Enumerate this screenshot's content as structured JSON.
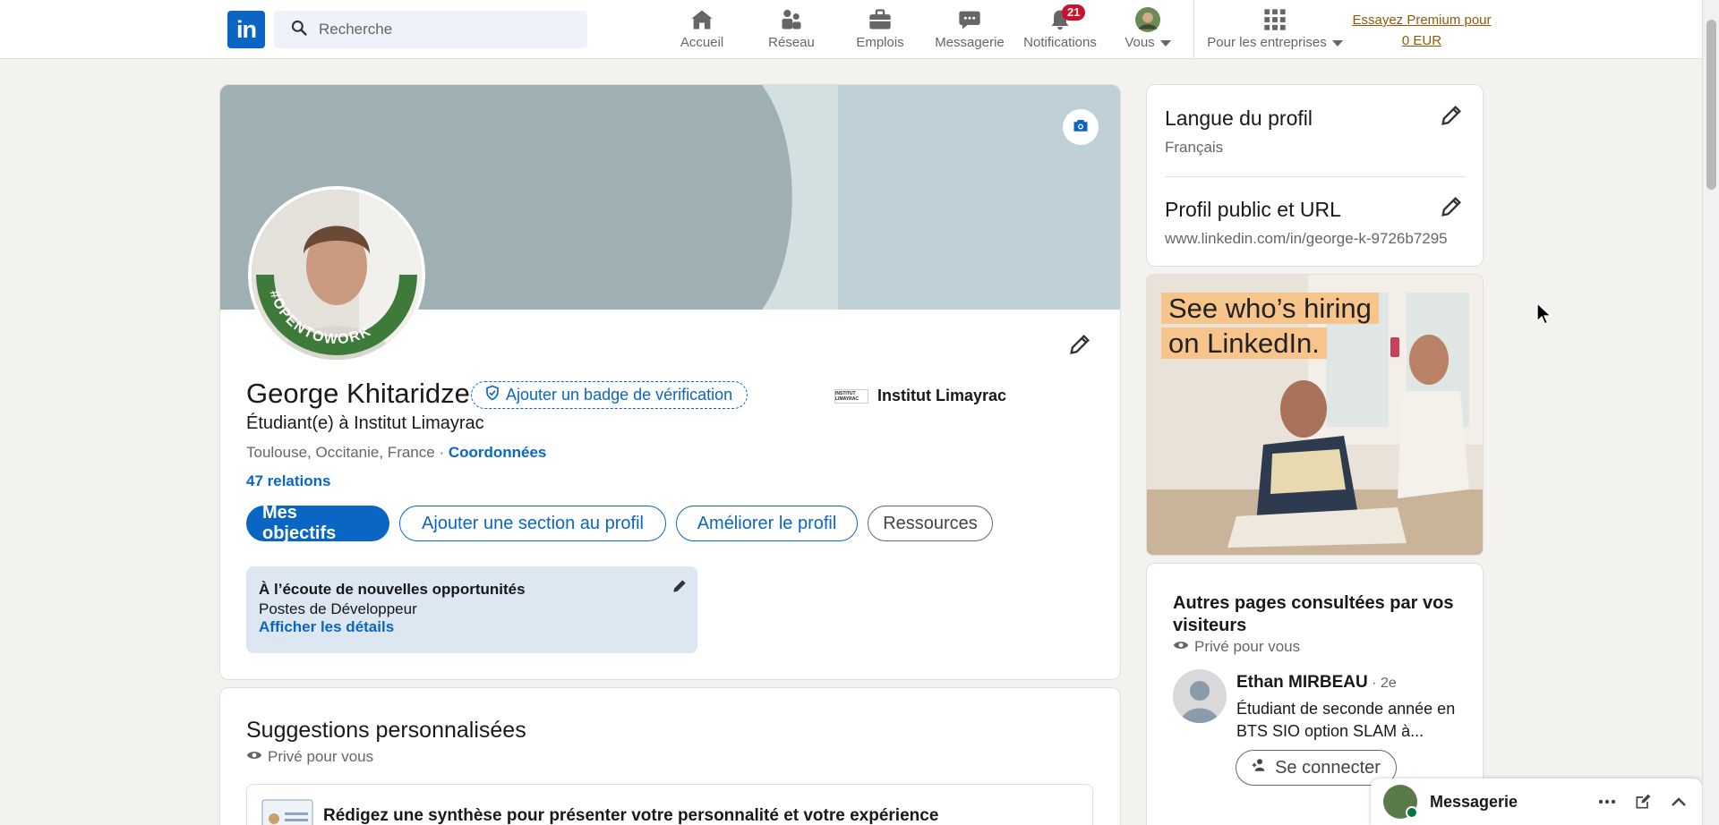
{
  "nav": {
    "logo": "in",
    "search_placeholder": "Recherche",
    "items": [
      {
        "label": "Accueil",
        "icon": "home-icon"
      },
      {
        "label": "Réseau",
        "icon": "network-icon"
      },
      {
        "label": "Emplois",
        "icon": "briefcase-icon"
      },
      {
        "label": "Messagerie",
        "icon": "chat-icon"
      },
      {
        "label": "Notifications",
        "icon": "bell-icon",
        "badge": "21"
      },
      {
        "label": "Vous",
        "icon": "avatar"
      },
      {
        "label": "Pour les entreprises",
        "icon": "grid-icon"
      }
    ],
    "premium_line1": "Essayez Premium pour",
    "premium_line2": "0 EUR"
  },
  "profile": {
    "name": "George Khitaridze",
    "verify_badge": "Ajouter un badge de vérification",
    "headline": "Étudiant(e) à Institut Limayrac",
    "location": "Toulouse, Occitanie, France · ",
    "contact_link": "Coordonnées",
    "relations": "47 relations",
    "school": "Institut Limayrac",
    "school_logo_text": "INSTITUT LIMAYRAC",
    "opentowork": "#OPENTOWORK",
    "buttons": {
      "objectives": "Mes objectifs",
      "add_section": "Ajouter une section au profil",
      "improve": "Améliorer le profil",
      "resources": "Ressources"
    },
    "open_to_work": {
      "title": "À l’écoute de nouvelles opportunités",
      "roles": "Postes de Développeur",
      "details_link": "Afficher les détails"
    }
  },
  "suggestions": {
    "title": "Suggestions personnalisées",
    "privacy": "Privé pour vous",
    "item_text": "Rédigez une synthèse pour présenter votre personnalité et votre expérience"
  },
  "sidebar": {
    "language_title": "Langue du profil",
    "language_value": "Français",
    "public_profile_title": "Profil public et URL",
    "public_profile_url": "www.linkedin.com/in/george-k-9726b7295",
    "ad_line1": "See who’s hiring",
    "ad_line2": "on LinkedIn.",
    "visitors_title_1": "Autres pages consultées par vos",
    "visitors_title_2": "visiteurs",
    "visitors_privacy": "Privé pour vous",
    "visitor": {
      "name": "Ethan MIRBEAU",
      "degree": " · 2e",
      "headline_1": "Étudiant de seconde année en",
      "headline_2": "BTS SIO option SLAM à...",
      "connect": "Se connecter"
    }
  },
  "messaging": {
    "label": "Messagerie"
  },
  "colors": {
    "brand": "#0a66c2",
    "premium": "#915907",
    "badge": "#cb112d",
    "opentowork": "#3e7a3a"
  }
}
